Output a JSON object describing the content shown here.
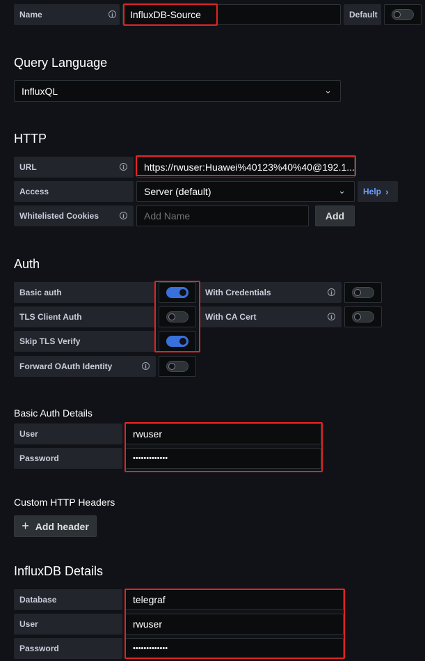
{
  "general": {
    "name_label": "Name",
    "name_value": "InfluxDB-Source",
    "default_label": "Default",
    "default_on": false
  },
  "query_language": {
    "title": "Query Language",
    "selected": "InfluxQL"
  },
  "http": {
    "title": "HTTP",
    "url_label": "URL",
    "url_value": "https://rwuser:Huawei%40123%40%40@192.1...",
    "access_label": "Access",
    "access_value": "Server (default)",
    "help_label": "Help",
    "help_chevron": "›",
    "cookies_label": "Whitelisted Cookies",
    "cookies_placeholder": "Add Name",
    "add_label": "Add"
  },
  "auth": {
    "title": "Auth",
    "basic_auth_label": "Basic auth",
    "basic_auth_on": true,
    "with_credentials_label": "With Credentials",
    "with_credentials_on": false,
    "tls_client_auth_label": "TLS Client Auth",
    "tls_client_auth_on": false,
    "with_ca_cert_label": "With CA Cert",
    "with_ca_cert_on": false,
    "skip_tls_label": "Skip TLS Verify",
    "skip_tls_on": true,
    "forward_oauth_label": "Forward OAuth Identity",
    "forward_oauth_on": false
  },
  "basic_auth_details": {
    "title": "Basic Auth Details",
    "user_label": "User",
    "user_value": "rwuser",
    "password_label": "Password",
    "password_value": "•••••••••••••"
  },
  "custom_headers": {
    "title": "Custom HTTP Headers",
    "add_header_icon": "+",
    "add_header_label": "Add header"
  },
  "influxdb_details": {
    "title": "InfluxDB Details",
    "database_label": "Database",
    "database_value": "telegraf",
    "user_label": "User",
    "user_value": "rwuser",
    "password_label": "Password",
    "password_value": "•••••••••••••"
  },
  "icons": {
    "info": "i",
    "chevron_down": "⌄"
  },
  "colors": {
    "background": "#111217",
    "label_bg": "#22252b",
    "input_bg": "#0b0c0e",
    "switch_on": "#3871dc",
    "link": "#6e9fff",
    "highlight": "#e02424"
  }
}
